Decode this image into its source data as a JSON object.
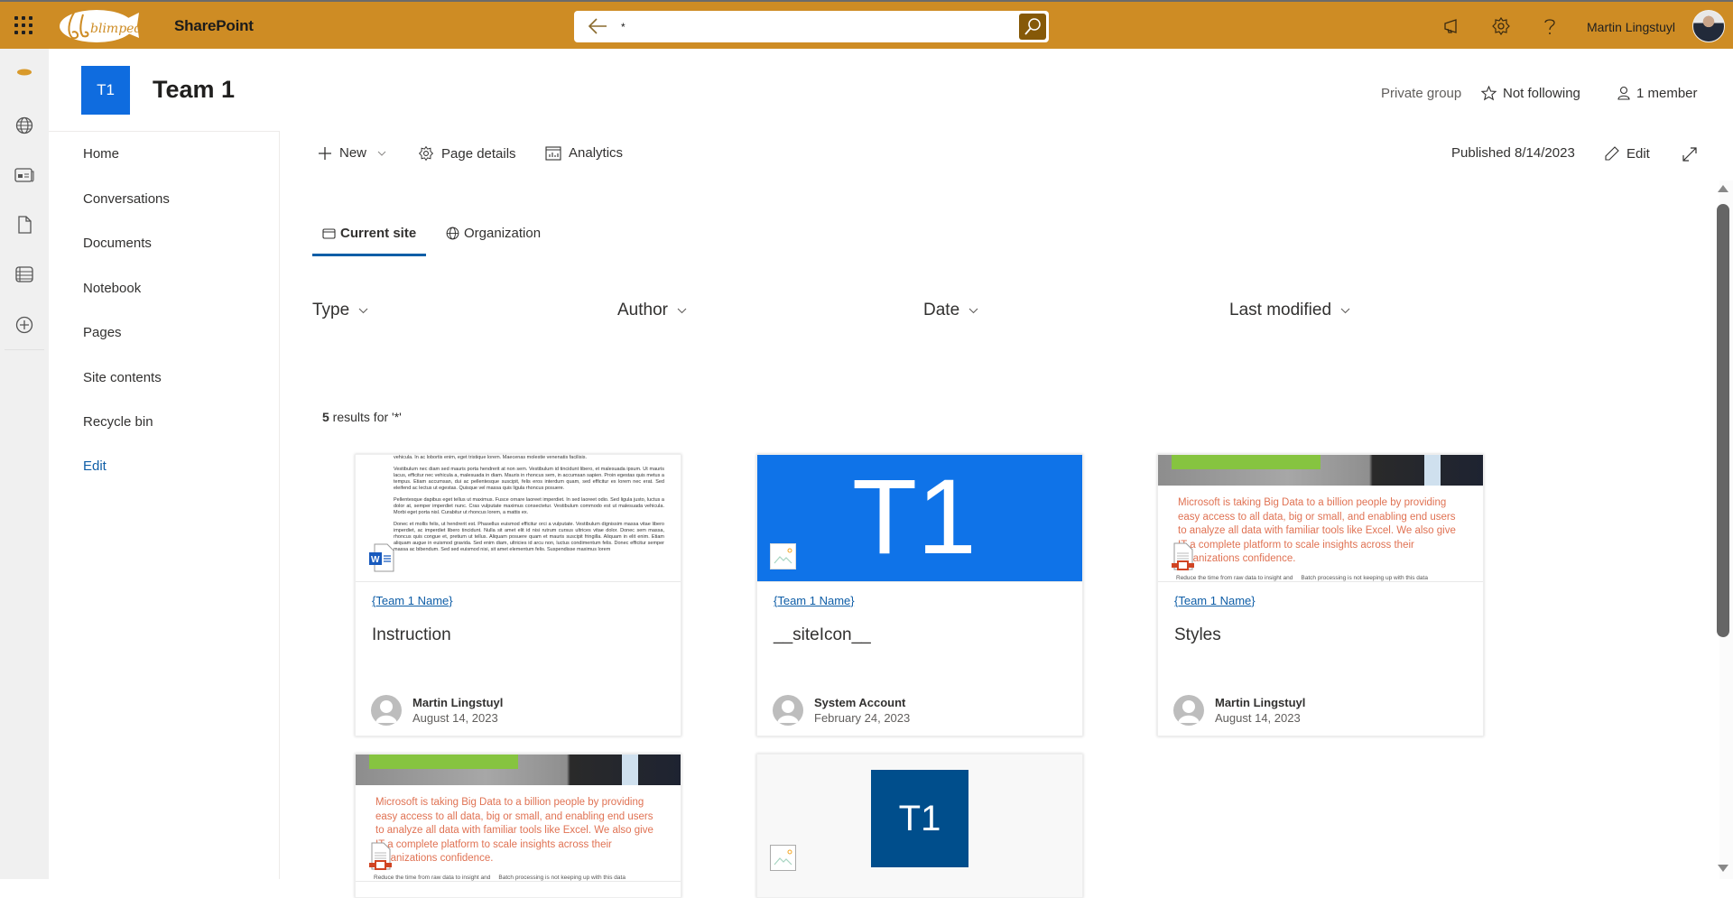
{
  "suitebar": {
    "app_name": "SharePoint",
    "brand_name": "blimped",
    "search": {
      "value": "*",
      "placeholder": ""
    },
    "user_name": "Martin Lingstuyl",
    "icons": [
      "waffle-icon",
      "back-arrow-icon",
      "search-icon",
      "megaphone-icon",
      "gear-icon",
      "help-icon"
    ],
    "accent_color": "#ce8c24",
    "search_button_color": "#865908"
  },
  "app_rail": {
    "items": [
      "home-logo-icon",
      "globe-icon",
      "news-icon",
      "document-icon",
      "list-icon",
      "add-icon"
    ]
  },
  "site": {
    "logo_text": "T1",
    "title": "Team 1",
    "privacy": "Private group",
    "follow_label": "Not following",
    "members_label": "1 member",
    "logo_color": "#0f6cdf"
  },
  "nav": {
    "items": [
      {
        "label": "Home"
      },
      {
        "label": "Conversations"
      },
      {
        "label": "Documents"
      },
      {
        "label": "Notebook"
      },
      {
        "label": "Pages"
      },
      {
        "label": "Site contents"
      },
      {
        "label": "Recycle bin"
      }
    ],
    "edit_label": "Edit"
  },
  "command_bar": {
    "new_label": "New",
    "page_details_label": "Page details",
    "analytics_label": "Analytics",
    "published_label": "Published 8/14/2023",
    "edit_label": "Edit"
  },
  "tabs": [
    {
      "label": "Current site",
      "active": true
    },
    {
      "label": "Organization",
      "active": false
    }
  ],
  "filters": [
    {
      "label": "Type"
    },
    {
      "label": "Author"
    },
    {
      "label": "Date"
    },
    {
      "label": "Last modified"
    }
  ],
  "results": {
    "count": "5",
    "text": " results for '*'"
  },
  "cards": [
    {
      "site": "{Team 1 Name}",
      "title": "Instruction",
      "author": "Martin Lingstuyl",
      "date": "August 14, 2023",
      "file_type": "word",
      "preview_paragraphs": [
        "vehicula. In ac lobortis enim, eget tristique lorem. Maecenas molestie venenatis facilisis.",
        "Vestibulum nec diam sed mauris porta hendrerit at non sem. Vestibulum id tincidunt libero, et malesuada ipsum. Ut mauris lacus, efficitur nec vehicula a, malesuada in diam. Mauris in rhoncus sem, in accumsan sapien. Proin egestas quis metus a tempus. Etiam accumsan, dui ac pellentesque suscipit, felis eros interdum quam, sed efficitur ex lorem nec erat. Sed eleifend ac lectus ut egestas. Quisque vel massa quis ligula rhoncus posuere.",
        "Pellentesque dapibus eget tellus ut maximus. Fusce ornare laoreet imperdiet. In sed laoreet odio. Sed ligula justo, luctus a dolor at, semper imperdiet nunc. Cras vulputate maximus consectetur. Vestibulum commodo est ut malesuada vehicula. Morbi eget porta nisl. Curabitur ut rhoncus lorem, a mattis ex.",
        "Donec et mollis felis, ut hendrerit est. Phasellus euismod efficitur orci a vulputate. Vestibulum dignissim massa vitae libero imperdiet, ac imperdiet libero tincidunt. Nulla sit amet elit id nisi rutrum cursus ultrices vitae dolor. Donec sem massa, rhoncus quis congue et, pretium ut tellus. Aliquam posuere quam et mauris suscipit fringilla. Aliquam in elit enim. Etiam aliquam augue in euismod gravida. Sed enim diam, ultricies id arcu non, luctus condimentum felis. Donec efficitur semper massa ac bibendum. Sed sed euismod nisi, sit amet elementum felis. Suspendisse maximus lorem"
      ]
    },
    {
      "site": "{Team 1 Name}",
      "title": "__siteIcon__",
      "author": "System Account",
      "date": "February 24, 2023",
      "file_type": "image",
      "thumb_text": "T1"
    },
    {
      "site": "{Team 1 Name}",
      "title": "Styles",
      "author": "Martin Lingstuyl",
      "date": "August 14, 2023",
      "file_type": "powerpoint",
      "preview_text": "Microsoft is taking Big Data to a billion people by providing easy access to all data, big or small, and enabling end users to analyze all data with familiar tools like Excel. We also give IT a complete platform to scale insights across their organizations confidence.",
      "preview_sub_left": "Reduce the time from raw data to insight and",
      "preview_sub_right": "Batch processing is not keeping up with this data"
    },
    {
      "file_type": "powerpoint",
      "preview_text": "Microsoft is taking Big Data to a billion people by providing easy access to all data, big or small, and enabling end users to analyze all data with familiar tools like Excel. We also give IT a complete platform to scale insights across their organizations confidence.",
      "preview_sub_left": "Reduce the time from raw data to insight and",
      "preview_sub_right": "Batch processing is not keeping up with this data"
    },
    {
      "file_type": "image",
      "thumb_text": "T1"
    }
  ]
}
